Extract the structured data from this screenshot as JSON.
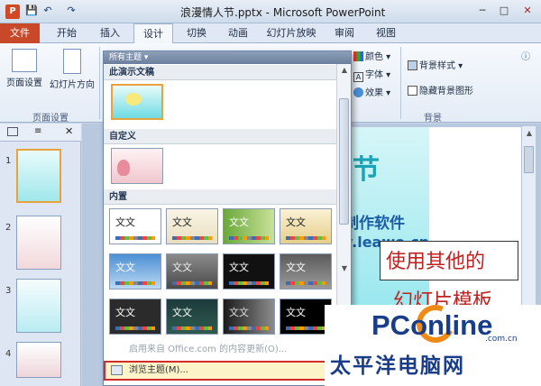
{
  "window": {
    "title": "浪漫情人节.pptx - Microsoft PowerPoint",
    "app_icon": "P",
    "qa": {
      "save": "💾",
      "undo": "↶",
      "redo": "↷"
    },
    "controls": {
      "minimize": "─",
      "maximize": "□",
      "close": "✕"
    }
  },
  "tabs": [
    {
      "label": "文件"
    },
    {
      "label": "开始"
    },
    {
      "label": "插入"
    },
    {
      "label": "设计"
    },
    {
      "label": "切换"
    },
    {
      "label": "动画"
    },
    {
      "label": "幻灯片放映"
    },
    {
      "label": "审阅"
    },
    {
      "label": "视图"
    }
  ],
  "ribbon": {
    "page_setup": "页面设置",
    "orientation": "幻灯片方向",
    "group_page_setup": "页面设置",
    "colors": "颜色",
    "fonts": "字体",
    "effects": "效果",
    "bg_styles": "背景样式",
    "hide_bg": "隐藏背景图形",
    "group_background": "背景"
  },
  "gallery": {
    "combo": "所有主题",
    "section_current": "此演示文稿",
    "section_custom": "自定义",
    "section_builtin": "内置",
    "thumb_text": "文文",
    "menu_online": "启用来自 Office.com 的内容更新(O)...",
    "menu_browse": "浏览主题(M)..."
  },
  "slide": {
    "line1": "节",
    "line2": "制作软件",
    "line3": "v.leawo.cn",
    "line4": "使用其他的",
    "line5": "幻灯片模板"
  },
  "panel": {
    "slide_numbers": [
      "1",
      "2",
      "3",
      "4"
    ]
  },
  "watermark": {
    "logo": "PConline",
    "domain": ".com.cn",
    "sub": "太平洋电脑网"
  },
  "colors": {
    "file_tab": "#c8482a",
    "highlight": "#d32a2a",
    "slide_title": "#1aa3b4"
  }
}
